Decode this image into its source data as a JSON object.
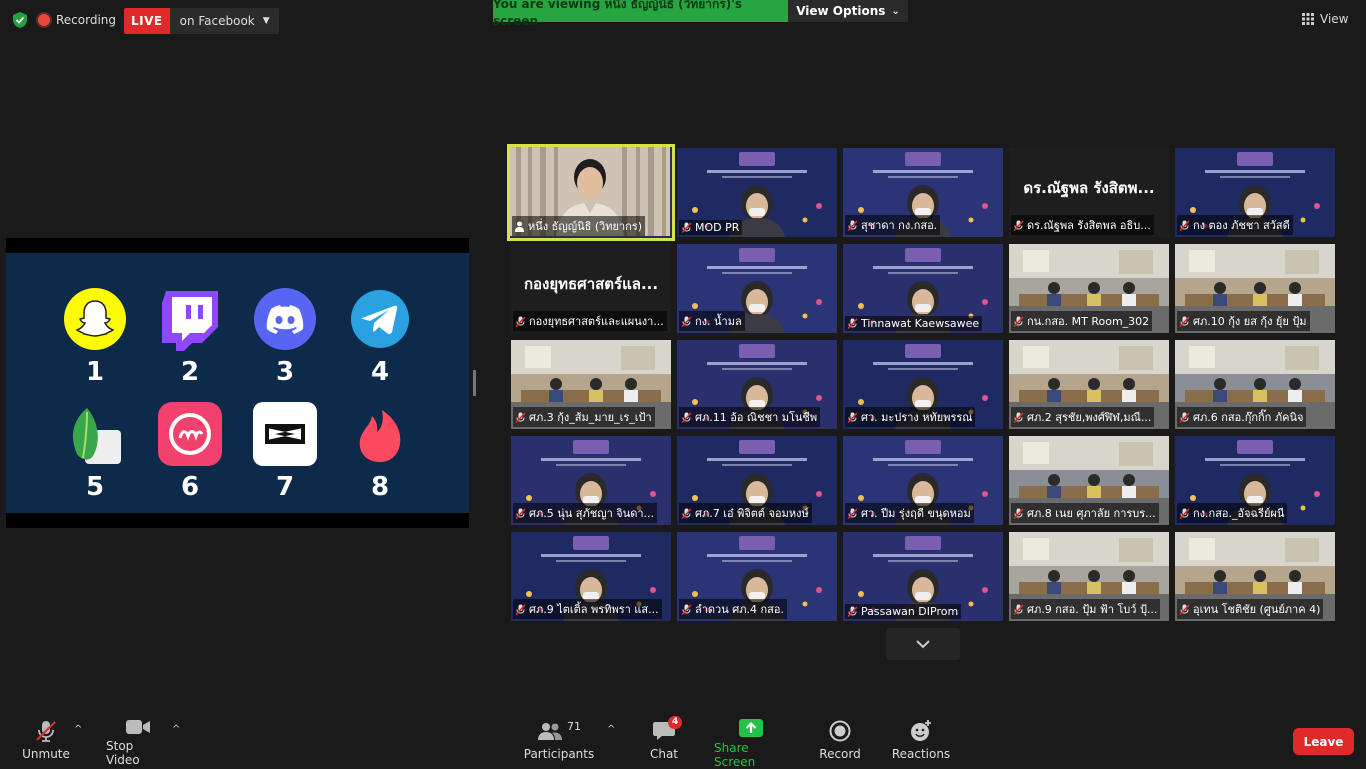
{
  "topbar": {
    "recording_label": "Recording",
    "live_badge": "LIVE",
    "live_destination": "on Facebook",
    "viewing_text": "You are viewing หนึ่ง ธัญญ์นิธิ (วิทยากร)'s screen",
    "view_options_label": "View Options",
    "view_label": "View"
  },
  "shared_screen": {
    "apps": [
      {
        "num": "1",
        "icon": "snapchat-icon",
        "color": "#fffc00"
      },
      {
        "num": "2",
        "icon": "twitch-icon",
        "color": "#9146ff"
      },
      {
        "num": "3",
        "icon": "discord-icon",
        "color": "#5865f2"
      },
      {
        "num": "4",
        "icon": "telegram-icon",
        "color": "#2aa1e0"
      },
      {
        "num": "5",
        "icon": "snapseed-icon",
        "color": "#3aa64a"
      },
      {
        "num": "6",
        "icon": "meitu-icon",
        "color": "#f2416c"
      },
      {
        "num": "7",
        "icon": "capcut-icon",
        "color": "#ffffff"
      },
      {
        "num": "8",
        "icon": "tinder-icon",
        "color": "#fe4a60"
      }
    ]
  },
  "participants_grid": [
    [
      {
        "name": "หนึ่ง ธัญญ์นิธิ (วิทยากร)",
        "big": "",
        "type": "camera",
        "active": true
      },
      {
        "name": "MOD PR",
        "big": "",
        "type": "slide"
      },
      {
        "name": "สุชาดา กง.กสอ.",
        "big": "",
        "type": "slide"
      },
      {
        "name": "ดร.ณัฐพล รังสิตพล อธิบ...",
        "big": "ดร.ณัฐพล รังสิตพ...",
        "type": "dark"
      },
      {
        "name": "กง ตอง ภัชชา สวัสดี",
        "big": "",
        "type": "slide"
      }
    ],
    [
      {
        "name": "กองยุทธศาสตร์และแผนงา...",
        "big": "กองยุทธศาสตร์แล...",
        "type": "dark"
      },
      {
        "name": "กง. น้ำมล",
        "big": "",
        "type": "slide"
      },
      {
        "name": "Tinnawat Kaewsawee",
        "big": "",
        "type": "slide"
      },
      {
        "name": "กน.กสอ. MT Room_302",
        "big": "",
        "type": "room"
      },
      {
        "name": "ศภ.10 กุ้ง ยส กุ้ง ยุ้ย ปุ้ม",
        "big": "",
        "type": "room"
      }
    ],
    [
      {
        "name": "ศภ.3 กุ้ง_ส้ม_มาย_เร_เป้า",
        "big": "",
        "type": "room"
      },
      {
        "name": "ศภ.11 อ้อ ณิชชา มโนชีพ",
        "big": "",
        "type": "slide"
      },
      {
        "name": "ศว. มะปราง หทัยพรรณ",
        "big": "",
        "type": "slide"
      },
      {
        "name": "ศภ.2 สุรชัย,พงศ์ฬิฬ,มณี...",
        "big": "",
        "type": "room"
      },
      {
        "name": "ศภ.6 กสอ.กุ๊กกิ๊ก ภัคนิจ",
        "big": "",
        "type": "room"
      }
    ],
    [
      {
        "name": "ศภ.5 นุ่น สุภัชญา จินดา...",
        "big": "",
        "type": "slide"
      },
      {
        "name": "ศภ.7 เอ๋ พิจิตต์ จอมหงษ์",
        "big": "",
        "type": "slide"
      },
      {
        "name": "ศว. ปีม รุ่งฤดี ขนุดหอม",
        "big": "",
        "type": "slide"
      },
      {
        "name": "ศภ.8 เนย ศุภาลัย การบร...",
        "big": "",
        "type": "room"
      },
      {
        "name": "กง.กสอ._อัจฉรีย์ผนี",
        "big": "",
        "type": "slide"
      }
    ],
    [
      {
        "name": "ศภ.9 ไตเติ้ล พรทิพรา แส...",
        "big": "",
        "type": "slide"
      },
      {
        "name": "ลำดวน ศภ.4 กสอ.",
        "big": "",
        "type": "slide"
      },
      {
        "name": "Passawan DIProm",
        "big": "",
        "type": "slide"
      },
      {
        "name": "ศภ.9 กสอ. ปุ้ม ฟ้า โบว์ ปุ้...",
        "big": "",
        "type": "room"
      },
      {
        "name": "อุเทน โชติชัย (ศูนย์ภาค 4)",
        "big": "",
        "type": "room"
      }
    ]
  ],
  "toolbar": {
    "unmute": "Unmute",
    "stop_video": "Stop Video",
    "participants": "Participants",
    "participants_count": "71",
    "chat": "Chat",
    "chat_badge": "4",
    "share_screen": "Share Screen",
    "record": "Record",
    "reactions": "Reactions",
    "leave": "Leave"
  },
  "colors": {
    "background": "#1a1a1a",
    "share_green": "#26a541",
    "live_red": "#e02a2a",
    "active_speaker": "#d6e24a",
    "slide_blue": "#232d5c"
  }
}
